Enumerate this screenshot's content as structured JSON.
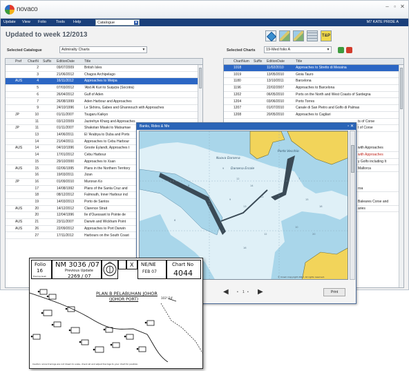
{
  "app": {
    "logo_text": "novaco",
    "menu": [
      "Update",
      "View",
      "Folio",
      "Tools",
      "Help"
    ],
    "menu_select_value": "Catalogue",
    "user": "M7 KATE PRIDE A",
    "page_title": "Updated to week  12/2013"
  },
  "left_panel": {
    "label": "Selected Catalogue",
    "dropdown_value": "Admiralty Charts",
    "columns": [
      "Pref",
      "ChartN",
      "Suffix",
      "EditionDate",
      "Title"
    ],
    "rows": [
      {
        "pref": "",
        "chart": "2",
        "suffix": "",
        "date": "09/07/2009",
        "title": "British Isles",
        "selected": false
      },
      {
        "pref": "",
        "chart": "3",
        "suffix": "",
        "date": "21/06/2012",
        "title": "Chagos Archipelago",
        "selected": false
      },
      {
        "pref": "AUS",
        "chart": "4",
        "suffix": "",
        "date": "16/11/2012",
        "title": "Approaches to Weipa",
        "selected": true
      },
      {
        "pref": "",
        "chart": "5",
        "suffix": "",
        "date": "07/03/2012",
        "title": "'Abd Al Kuri to Suquțra (Socotra)",
        "selected": false
      },
      {
        "pref": "",
        "chart": "6",
        "suffix": "",
        "date": "26/04/2012",
        "title": "Gulf of Aden",
        "selected": false
      },
      {
        "pref": "",
        "chart": "7",
        "suffix": "",
        "date": "26/08/1999",
        "title": "Aden Harbour and Approaches",
        "selected": false
      },
      {
        "pref": "",
        "chart": "9",
        "suffix": "",
        "date": "24/10/1996",
        "title": "Le Skhirra, Gabes and Ghannouch with Approaches",
        "selected": false
      },
      {
        "pref": "JP",
        "chart": "10",
        "suffix": "",
        "date": "01/11/2007",
        "title": "Tsugaru Kaikyo",
        "selected": false
      },
      {
        "pref": "",
        "chart": "11",
        "suffix": "",
        "date": "03/12/2009",
        "title": "Jazirehye Kharg and Approaches",
        "selected": false
      },
      {
        "pref": "JP",
        "chart": "11",
        "suffix": "",
        "date": "01/11/2007",
        "title": "Shakotan Misaki to Matsumae",
        "selected": false
      },
      {
        "pref": "",
        "chart": "13",
        "suffix": "",
        "date": "14/06/2011",
        "title": "El 'Arabiya to Duba and Ports",
        "selected": false
      },
      {
        "pref": "",
        "chart": "14",
        "suffix": "",
        "date": "21/04/2011",
        "title": "Approaches to Cebu Harbour",
        "selected": false
      },
      {
        "pref": "AUS",
        "chart": "14",
        "suffix": "",
        "date": "04/10/1996",
        "title": "Groote Eylandt, Approaches t",
        "selected": false
      },
      {
        "pref": "",
        "chart": "14",
        "suffix": "",
        "date": "17/01/2012",
        "title": "Cebu Harbour",
        "selected": false
      },
      {
        "pref": "",
        "chart": "15",
        "suffix": "",
        "date": "29/10/2000",
        "title": "Approaches to Xsan",
        "selected": false
      },
      {
        "pref": "AUS",
        "chart": "15",
        "suffix": "",
        "date": "02/06/1995",
        "title": "Plans in the Northern Territory",
        "selected": false
      },
      {
        "pref": "",
        "chart": "16",
        "suffix": "",
        "date": "19/03/2011",
        "title": "Jizan",
        "selected": false
      },
      {
        "pref": "JP",
        "chart": "16",
        "suffix": "",
        "date": "01/09/2010",
        "title": "Muroran Ko",
        "selected": false
      },
      {
        "pref": "",
        "chart": "17",
        "suffix": "",
        "date": "14/08/1992",
        "title": "Plans of the Santa Cruz and",
        "selected": false
      },
      {
        "pref": "",
        "chart": "18",
        "suffix": "",
        "date": "08/12/2012",
        "title": "Falmouth, Inner Harbour incl",
        "selected": false
      },
      {
        "pref": "",
        "chart": "19",
        "suffix": "",
        "date": "14/03/2013",
        "title": "Porto de Santos",
        "selected": false
      },
      {
        "pref": "AUS",
        "chart": "20",
        "suffix": "",
        "date": "14/12/2012",
        "title": "Clarence Strait",
        "selected": false
      },
      {
        "pref": "",
        "chart": "20",
        "suffix": "",
        "date": "12/04/1996",
        "title": "Ile d'Ouessant to Pointe de",
        "selected": false
      },
      {
        "pref": "AUS",
        "chart": "21",
        "suffix": "",
        "date": "23/11/2007",
        "title": "Darwin and Wickham Point",
        "selected": false
      },
      {
        "pref": "AUS",
        "chart": "26",
        "suffix": "",
        "date": "22/09/2012",
        "title": "Approaches to Port Darwin",
        "selected": false
      },
      {
        "pref": "",
        "chart": "27",
        "suffix": "",
        "date": "17/11/2012",
        "title": "Harbours on the South Coast",
        "selected": false
      }
    ]
  },
  "right_panel": {
    "label": "Selected Charts",
    "dropdown_value": "19-Med folio A",
    "columns": [
      "ChartNum",
      "Suffix",
      "EditionDate",
      "Title"
    ],
    "rows": [
      {
        "chart": "1018",
        "suffix": "",
        "date": "11/02/2010",
        "title": "Approaches to Stretto di Messina",
        "selected": true,
        "red": false
      },
      {
        "chart": "1019",
        "suffix": "",
        "date": "13/05/2010",
        "title": "Gioia Tauro",
        "selected": false,
        "red": false
      },
      {
        "chart": "1180",
        "suffix": "",
        "date": "13/10/2011",
        "title": "Barcelona",
        "selected": false,
        "red": false
      },
      {
        "chart": "1196",
        "suffix": "",
        "date": "22/02/2007",
        "title": "Approaches to Barcelona",
        "selected": false,
        "red": false
      },
      {
        "chart": "1202",
        "suffix": "",
        "date": "06/05/2010",
        "title": "Ports on the North and West Coasts of Sardegna",
        "selected": false,
        "red": false
      },
      {
        "chart": "1204",
        "suffix": "",
        "date": "03/06/2010",
        "title": "Porto Torres",
        "selected": false,
        "red": false
      },
      {
        "chart": "1207",
        "suffix": "",
        "date": "01/07/2010",
        "title": "Canale di San Pietro and Golfo di Palmas",
        "selected": false,
        "red": false
      },
      {
        "chart": "1208",
        "suffix": "",
        "date": "20/05/2010",
        "title": "Approaches to Cagliari",
        "selected": false,
        "red": false
      }
    ],
    "partial_titles": [
      {
        "text": "ts of Corse",
        "red": false
      },
      {
        "text": "t of Corse",
        "red": false
      },
      {
        "text": "with Approaches",
        "red": false
      },
      {
        "text": "with Approaches",
        "red": true
      },
      {
        "text": "y Golfo including It",
        "red": false
      },
      {
        "text": "Mallorca",
        "red": false
      },
      {
        "text": "roa",
        "red": false
      },
      {
        "text": "Baleares Corse and",
        "red": false
      },
      {
        "text": "aries",
        "red": false
      }
    ]
  },
  "popup": {
    "title": "Banks, Rides & Nfe",
    "map_label_1": "Nuova Darsena",
    "map_label_2": "Darsena Ercole",
    "map_label_3": "Porto Vecchio",
    "copyright": "© Crown Copyright 2012. All rights reserved.",
    "nav_page": "1",
    "print_label": "Print"
  },
  "document": {
    "folio_label": "Folio",
    "folio_number": "16",
    "nm_label": "NM 3036 /07",
    "prev_update_label": "Previous Update",
    "prev_update_value": "2269 / 07",
    "x_mark": "X",
    "ne_label": "NE/NE",
    "ne_date": "FEB 07",
    "chart_no_label": "Chart No",
    "chart_no_value": "4044",
    "plan_title": "PLAN B PELABUHAN JOHOR",
    "plan_subtitle": "(JOHOR PORT)",
    "tracing_label": "Tracing Gust",
    "coord_label": "103° 54'",
    "caution_text": "Caution: since tracings are not drawn to scale, check all and adjust tracings to your chart for position."
  },
  "colors": {
    "menubar": "#1a3f7a",
    "selection": "#2b66c4",
    "popup_title": "#2a64b7",
    "sea_shallow": "#a9d6ea",
    "sea_deep": "#dff0f7",
    "land": "#f2d45a"
  }
}
